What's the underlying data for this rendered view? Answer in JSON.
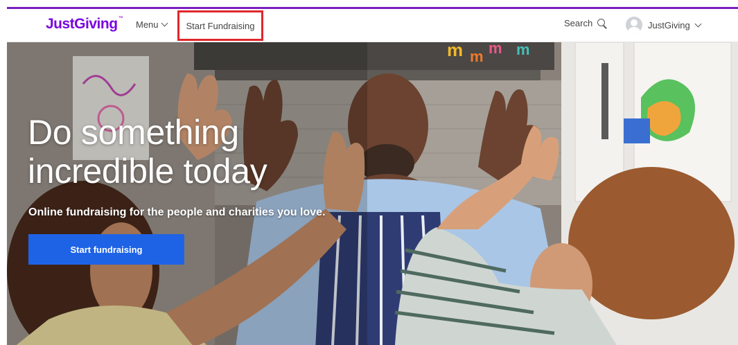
{
  "navbar": {
    "logo": "JustGiving",
    "logo_tm": "™",
    "menu_label": "Menu",
    "start_fundraising_label": "Start Fundraising",
    "search_label": "Search",
    "account_label": "JustGiving"
  },
  "hero": {
    "title_line1": "Do something",
    "title_line2": "incredible today",
    "subtitle": "Online fundraising for the people and charities you love.",
    "cta_label": "Start fundraising"
  },
  "colors": {
    "brand_purple": "#7a04dd",
    "cta_blue": "#1e63e6",
    "highlight_red": "#e0262b"
  },
  "icons": [
    "chevron-down-icon",
    "search-icon",
    "avatar-icon"
  ]
}
